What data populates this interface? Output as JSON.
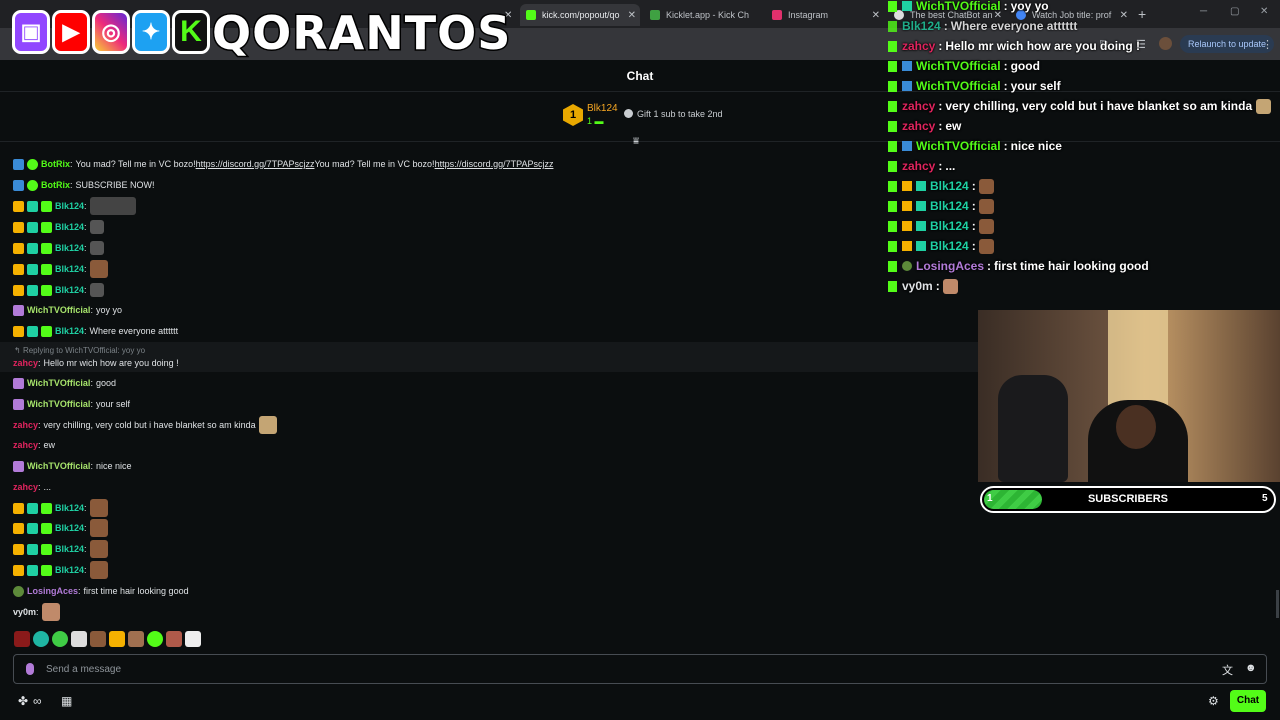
{
  "browser": {
    "tabs": [
      {
        "label": "kick.com/popout/qo",
        "active": true
      },
      {
        "label": "Kicklet.app - Kick Ch",
        "active": false
      },
      {
        "label": "Instagram",
        "active": false
      },
      {
        "label": "The best ChatBot an",
        "active": false
      },
      {
        "label": "Watch Job title: prof",
        "active": false
      }
    ],
    "relaunch_label": "Relaunch to update"
  },
  "overlay": {
    "brand": "QORANTOS",
    "socials": [
      "twitch-logo",
      "youtube-logo",
      "instagram-logo",
      "twitter-logo",
      "kick-logo"
    ]
  },
  "chat": {
    "title": "Chat",
    "pinned": {
      "rank": "1",
      "user": "Blk124",
      "count": "1",
      "gift_text": "Gift 1 sub to take 2nd"
    },
    "reply_to": "Replying to WichTVOfficial: yoy yo",
    "messages": [
      {
        "user": "BotRix",
        "text": "You mad? Tell me in VC bozo! ",
        "link": "https://discord.gg/7TPAPscjzz",
        "text2": "You mad? Tell me in VC bozo! ",
        "link2": "https://discord.gg/7TPAPscjzz"
      },
      {
        "user": "BotRix",
        "text": "SUBSCRIBE NOW!"
      },
      {
        "user": "Blk124",
        "text": ""
      },
      {
        "user": "Blk124",
        "text": ""
      },
      {
        "user": "Blk124",
        "text": ""
      },
      {
        "user": "Blk124",
        "text": ""
      },
      {
        "user": "Blk124",
        "text": ""
      },
      {
        "user": "WichTVOfficial",
        "text": "yoy yo"
      },
      {
        "user": "Blk124",
        "text": "Where everyone atttttt"
      },
      {
        "user": "zahcy",
        "text": "Hello mr wich how are you doing !"
      },
      {
        "user": "WichTVOfficial",
        "text": "good"
      },
      {
        "user": "WichTVOfficial",
        "text": "your self"
      },
      {
        "user": "zahcy",
        "text": "very chilling, very cold but i have blanket so am kinda"
      },
      {
        "user": "zahcy",
        "text": "ew"
      },
      {
        "user": "WichTVOfficial",
        "text": "nice nice"
      },
      {
        "user": "zahcy",
        "text": "..."
      },
      {
        "user": "Blk124",
        "text": ""
      },
      {
        "user": "Blk124",
        "text": ""
      },
      {
        "user": "Blk124",
        "text": ""
      },
      {
        "user": "Blk124",
        "text": ""
      },
      {
        "user": "LosingAces",
        "text": "first time hair looking good"
      },
      {
        "user": "vy0m",
        "text": ""
      }
    ],
    "input_placeholder": "Send a message",
    "send_label": "Chat",
    "colors": {
      "accent": "#53fc18",
      "botrix": "#53fc18",
      "blk124": "#1fd0a3",
      "wich": "#a6e36b",
      "zahcy": "#e0245e",
      "losingaces": "#b27bd8",
      "vy0m": "#dfe2e5"
    }
  },
  "overlay_chat": [
    {
      "user": "WichTVOfficial",
      "text": "yoy yo"
    },
    {
      "user": "Blk124",
      "text": "Where everyone atttttt"
    },
    {
      "user": "zahcy",
      "text": "Hello mr wich how are you doing !"
    },
    {
      "user": "WichTVOfficial",
      "text": "good"
    },
    {
      "user": "WichTVOfficial",
      "text": "your self"
    },
    {
      "user": "zahcy",
      "text": "very chilling, very cold but i have blanket so am kinda"
    },
    {
      "user": "zahcy",
      "text": "ew"
    },
    {
      "user": "WichTVOfficial",
      "text": "nice nice"
    },
    {
      "user": "zahcy",
      "text": "..."
    },
    {
      "user": "Blk124",
      "text": ""
    },
    {
      "user": "Blk124",
      "text": ""
    },
    {
      "user": "Blk124",
      "text": ""
    },
    {
      "user": "Blk124",
      "text": ""
    },
    {
      "user": "LosingAces",
      "text": "first time hair looking good"
    },
    {
      "user": "vy0m",
      "text": ""
    }
  ],
  "sub_goal": {
    "label": "SUBSCRIBERS",
    "current": "1",
    "goal": "5",
    "progress_fraction": 0.2
  }
}
